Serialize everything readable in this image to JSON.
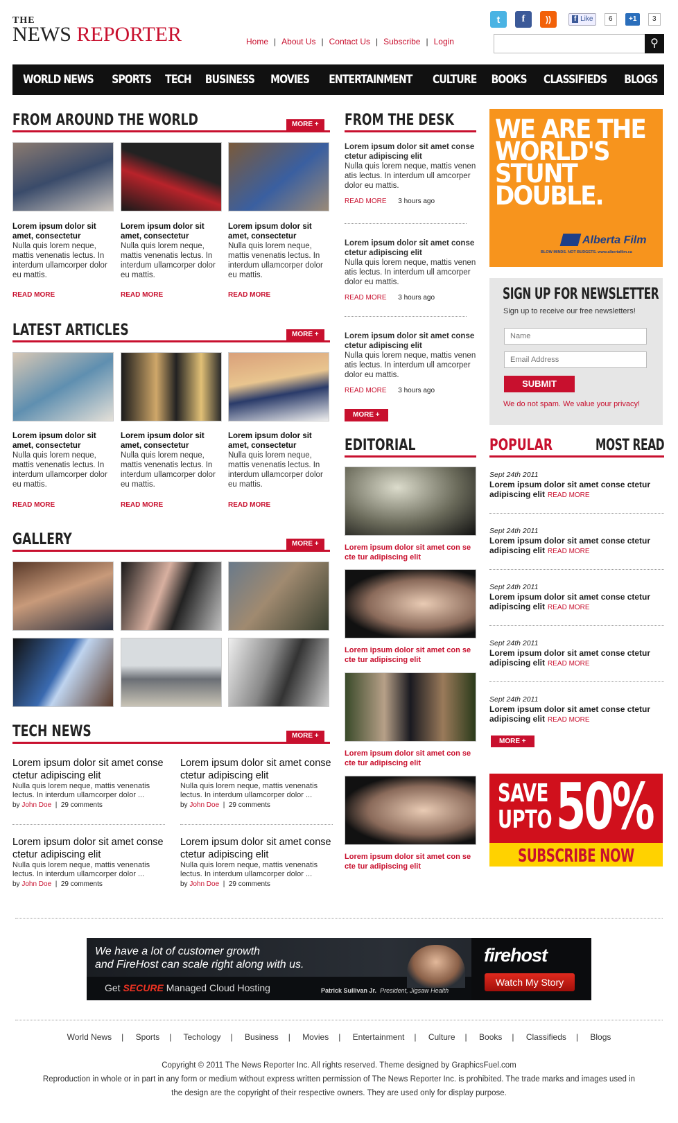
{
  "header": {
    "logo_the": "THE",
    "logo_news": "NEWS",
    "logo_reporter": "REPORTER",
    "top_links": [
      "Home",
      "About Us",
      "Contact Us",
      "Subscribe",
      "Login"
    ],
    "fb_like": "Like",
    "fb_count": "6",
    "gplus": "+1",
    "gplus_count": "3"
  },
  "main_nav": [
    "WORLD NEWS",
    "SPORTS",
    "TECH",
    "BUSINESS",
    "MOVIES",
    "ENTERTAINMENT",
    "CULTURE",
    "BOOKS",
    "CLASSIFIEDS",
    "BLOGS"
  ],
  "more_label": "MORE +",
  "read_more": "READ MORE",
  "around": {
    "title": "FROM AROUND THE WORLD",
    "items": [
      {
        "headline": "Lorem ipsum dolor sit amet, consectetur",
        "body": "Nulla quis lorem neque, mattis venenatis lectus. In interdum ullamcorper dolor eu mattis."
      },
      {
        "headline": "Lorem ipsum dolor sit amet, consectetur",
        "body": "Nulla quis lorem neque, mattis venenatis lectus. In interdum ullamcorper dolor eu mattis."
      },
      {
        "headline": "Lorem ipsum dolor sit amet, consectetur",
        "body": "Nulla quis lorem neque, mattis venenatis lectus. In interdum ullamcorper dolor eu mattis."
      }
    ]
  },
  "latest": {
    "title": "LATEST ARTICLES",
    "items": [
      {
        "headline": "Lorem ipsum dolor sit amet, consectetur",
        "body": "Nulla quis lorem neque, mattis venenatis lectus. In interdum ullamcorper dolor eu mattis."
      },
      {
        "headline": "Lorem ipsum dolor sit amet, consectetur",
        "body": "Nulla quis lorem neque, mattis venenatis lectus. In interdum ullamcorper dolor eu mattis."
      },
      {
        "headline": "Lorem ipsum dolor sit amet, consectetur",
        "body": "Nulla quis lorem neque, mattis venenatis lectus. In interdum ullamcorper dolor eu mattis."
      }
    ]
  },
  "gallery": {
    "title": "GALLERY"
  },
  "tech": {
    "title": "TECH NEWS",
    "items": [
      {
        "headline": "Lorem ipsum dolor sit amet conse ctetur adipiscing elit",
        "body": "Nulla quis lorem neque, mattis venenatis lectus. In interdum ullamcorper dolor ...",
        "by": "by",
        "author": "John Doe",
        "comments": "29 comments"
      },
      {
        "headline": "Lorem ipsum dolor sit amet conse ctetur adipiscing elit",
        "body": "Nulla quis lorem neque, mattis venenatis lectus. In interdum ullamcorper dolor ...",
        "by": "by",
        "author": "John Doe",
        "comments": "29 comments"
      },
      {
        "headline": "Lorem ipsum dolor sit amet conse ctetur adipiscing elit",
        "body": "Nulla quis lorem neque, mattis venenatis lectus. In interdum ullamcorper dolor ...",
        "by": "by",
        "author": "John Doe",
        "comments": "29 comments"
      },
      {
        "headline": "Lorem ipsum dolor sit amet conse ctetur adipiscing elit",
        "body": "Nulla quis lorem neque, mattis venenatis lectus. In interdum ullamcorper dolor ...",
        "by": "by",
        "author": "John Doe",
        "comments": "29 comments"
      }
    ]
  },
  "desk": {
    "title": "FROM THE DESK",
    "items": [
      {
        "headline": "Lorem ipsum dolor sit amet conse ctetur adipiscing elit",
        "body": "Nulla quis lorem neque, mattis venen atis lectus. In interdum ull amcorper dolor eu mattis.",
        "time": "3 hours ago"
      },
      {
        "headline": "Lorem ipsum dolor sit amet conse ctetur adipiscing elit",
        "body": "Nulla quis lorem neque, mattis venen atis lectus. In interdum ull amcorper dolor eu mattis.",
        "time": "3 hours ago"
      },
      {
        "headline": "Lorem ipsum dolor sit amet conse ctetur adipiscing elit",
        "body": "Nulla quis lorem neque, mattis venen atis lectus. In interdum ull amcorper dolor eu mattis.",
        "time": "3 hours ago"
      }
    ]
  },
  "editorial": {
    "title": "EDITORIAL",
    "captions": [
      "Lorem ipsum dolor sit amet con se cte tur adipiscing elit",
      "Lorem ipsum dolor sit amet con se cte tur adipiscing elit",
      "Lorem ipsum dolor sit amet con se cte tur adipiscing elit",
      "Lorem ipsum dolor sit amet con se cte tur adipiscing elit"
    ]
  },
  "ad_alberta": {
    "line1": "WE ARE THE",
    "line2": "WORLD'S",
    "line3": "STUNT",
    "line4": "DOUBLE.",
    "brand": "Alberta Film",
    "tagline": "BLOW MINDS. NOT BUDGETS.",
    "url": "www.albertafilm.ca"
  },
  "newsletter": {
    "title": "SIGN UP FOR NEWSLETTER",
    "sub": "Sign up to receive our free newsletters!",
    "name_ph": "Name",
    "email_ph": "Email Address",
    "submit": "SUBMIT",
    "privacy": "We do not spam. We value your privacy!"
  },
  "popular": {
    "tab1": "POPULAR",
    "tab2": "MOST READ",
    "items": [
      {
        "date": "Sept 24th 2011",
        "text": "Lorem ipsum dolor sit amet conse ctetur adipiscing elit"
      },
      {
        "date": "Sept 24th 2011",
        "text": "Lorem ipsum dolor sit amet conse ctetur adipiscing elit"
      },
      {
        "date": "Sept 24th 2011",
        "text": "Lorem ipsum dolor sit amet conse ctetur adipiscing elit"
      },
      {
        "date": "Sept 24th 2011",
        "text": "Lorem ipsum dolor sit amet conse ctetur adipiscing elit"
      },
      {
        "date": "Sept 24th 2011",
        "text": "Lorem ipsum dolor sit amet conse ctetur adipiscing elit"
      }
    ]
  },
  "ad_save": {
    "save": "SAVE",
    "upto": "UPTO",
    "pct": "50%",
    "cta": "SUBSCRIBE NOW"
  },
  "banner": {
    "quote1": "We have a lot of customer growth",
    "quote2": "and FireHost can scale right along with us.",
    "get": "Get",
    "secure": "SECURE",
    "managed": "Managed Cloud Hosting",
    "person": "Patrick Sullivan Jr.",
    "role": "President, Jigsaw Health",
    "brand": "firehost",
    "cta": "Watch My Story"
  },
  "footer": {
    "links": [
      "World News",
      "Sports",
      "Techology",
      "Business",
      "Movies",
      "Entertainment",
      "Culture",
      "Books",
      "Classifieds",
      "Blogs"
    ],
    "copy1": "Copyright © 2011 The News Reporter Inc. All rights reserved. Theme designed by GraphicsFuel.com",
    "copy2": "Reproduction in whole or in part in any form or medium without express written permission of The News Reporter Inc. is prohibited. The trade marks and images used in",
    "copy3": "the design are the copyright of their respective owners. They are used only for display purpose."
  }
}
